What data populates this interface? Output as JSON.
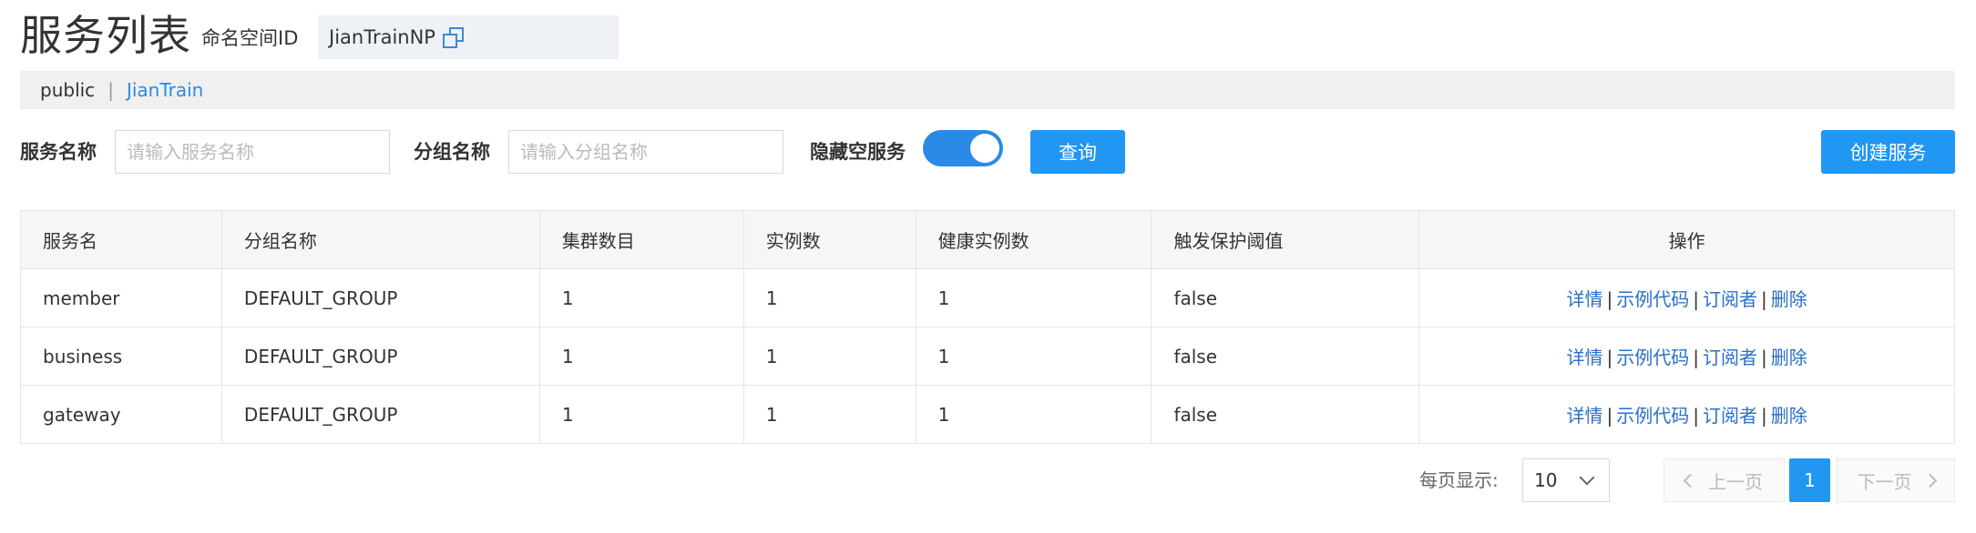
{
  "header": {
    "title": "服务列表",
    "namespace_label": "命名空间ID",
    "namespace_value": "JianTrainNP"
  },
  "namespaces": {
    "items": [
      "public",
      "JianTrain"
    ],
    "separator": "|",
    "active": "JianTrain"
  },
  "filters": {
    "service_name_label": "服务名称",
    "service_name_placeholder": "请输入服务名称",
    "group_name_label": "分组名称",
    "group_name_placeholder": "请输入分组名称",
    "hide_empty_label": "隐藏空服务",
    "hide_empty_on": true,
    "query_label": "查询",
    "create_label": "创建服务"
  },
  "table": {
    "columns": [
      "服务名",
      "分组名称",
      "集群数目",
      "实例数",
      "健康实例数",
      "触发保护阈值",
      "操作"
    ],
    "rows": [
      [
        "member",
        "DEFAULT_GROUP",
        "1",
        "1",
        "1",
        "false"
      ],
      [
        "business",
        "DEFAULT_GROUP",
        "1",
        "1",
        "1",
        "false"
      ],
      [
        "gateway",
        "DEFAULT_GROUP",
        "1",
        "1",
        "1",
        "false"
      ]
    ],
    "actions": [
      "详情",
      "示例代码",
      "订阅者",
      "删除"
    ],
    "action_separator": "|"
  },
  "pagination": {
    "page_size_label": "每页显示:",
    "page_size": "10",
    "prev_label": "上一页",
    "next_label": "下一页",
    "current_page": "1"
  },
  "colors": {
    "accent": "#2196f3",
    "link": "#2a6fc9",
    "namespace_bar": "#f0f0f0"
  }
}
